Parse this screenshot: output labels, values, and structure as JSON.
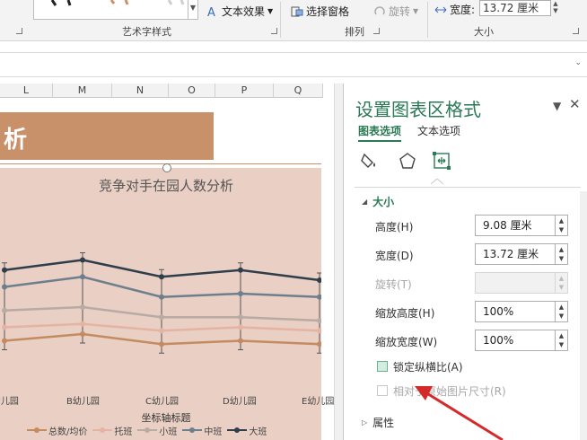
{
  "ribbon": {
    "wordart_effect_label": "文本效果",
    "wordart_group_label": "艺术字样式",
    "select_pane_label": "选择窗格",
    "rotate_label": "旋转",
    "arrange_group_label": "排列",
    "width_label": "宽度:",
    "width_value": "13.72 厘米",
    "size_group_label": "大小"
  },
  "sheet": {
    "columns": [
      "L",
      "M",
      "N",
      "O",
      "P",
      "Q"
    ]
  },
  "chart": {
    "banner_text": "析",
    "title_placeholder_empty": ""
  },
  "chart_data": {
    "type": "line",
    "title": "竞争对手在园人数分析",
    "xlabel": "坐标轴标题",
    "ylabel": "",
    "categories": [
      "A幼儿园",
      "B幼儿园",
      "C幼儿园",
      "D幼儿园",
      "E幼儿园"
    ],
    "x_tick_labels_visible": [
      "A幼儿园",
      "B幼儿园",
      "C幼儿园",
      "D幼儿园",
      "E幼儿园"
    ],
    "error_bars": true,
    "series": [
      {
        "name": "总数/均价",
        "values": [
          10,
          12,
          9,
          10,
          9
        ],
        "color": "#c48a61"
      },
      {
        "name": "托班",
        "values": [
          14,
          15,
          13,
          14,
          13
        ],
        "color": "#e5b3a3"
      },
      {
        "name": "小班",
        "values": [
          19,
          20,
          17,
          17,
          16
        ],
        "color": "#b9aaa4"
      },
      {
        "name": "中班",
        "values": [
          26,
          29,
          23,
          24,
          23
        ],
        "color": "#6e7f8c"
      },
      {
        "name": "大班",
        "values": [
          31,
          34,
          29,
          31,
          28
        ],
        "color": "#2f3e4b"
      }
    ]
  },
  "pane": {
    "title": "设置图表区格式",
    "tab_chart": "图表选项",
    "tab_text": "文本选项",
    "section_size": "大小",
    "height_label": "高度(H)",
    "height_value": "9.08 厘米",
    "width_label": "宽度(D)",
    "width_value": "13.72 厘米",
    "rotate_label": "旋转(T)",
    "rotate_value": "",
    "scale_h_label": "缩放高度(H)",
    "scale_h_value": "100%",
    "scale_w_label": "缩放宽度(W)",
    "scale_w_value": "100%",
    "lock_aspect_label": "锁定纵横比(A)",
    "relative_label": "相对于原始图片尺寸(R)",
    "section_props": "属性"
  },
  "colors": {
    "accent_green": "#2b7a55",
    "banner_brown": "#c9916a",
    "plot_bg": "#e9cfc4",
    "annotation_red": "#d42a2a"
  }
}
